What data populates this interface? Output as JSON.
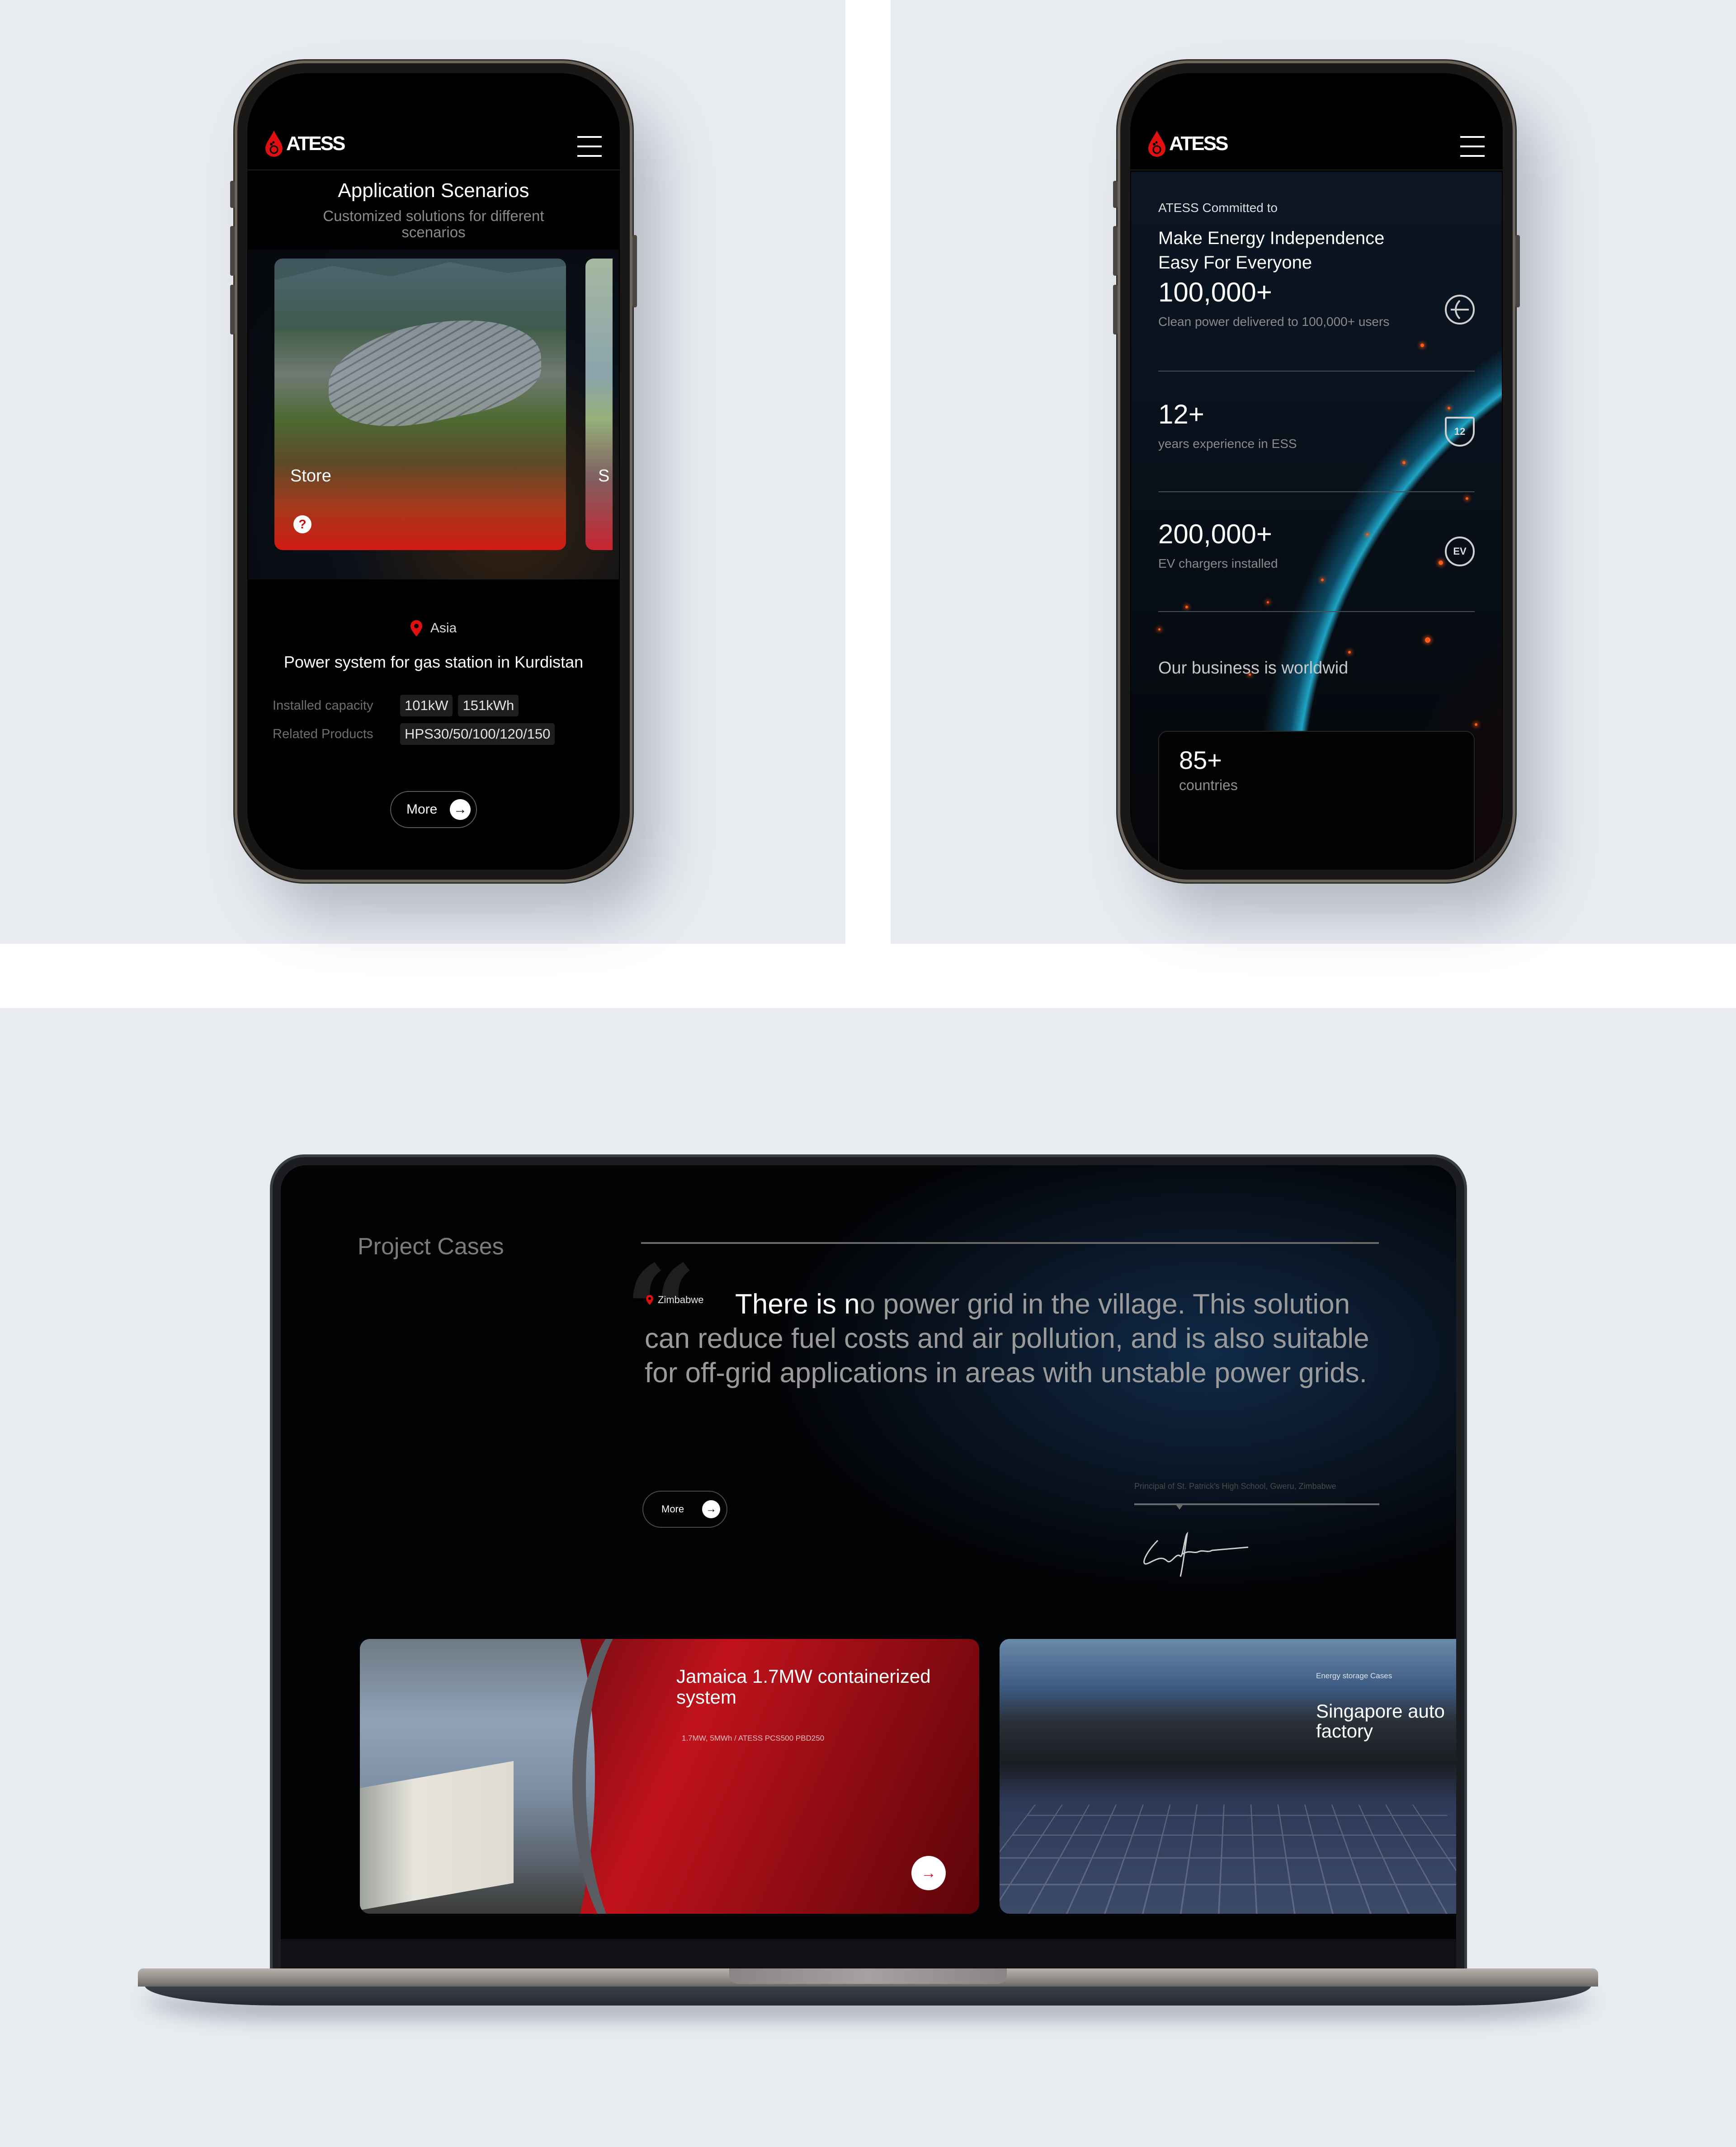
{
  "brand": {
    "name": "ATESS",
    "accent_color": "#d01a1a"
  },
  "phone_left": {
    "header": {
      "logo_text": "ATESS",
      "menu_icon": "hamburger-icon"
    },
    "section_title": "Application Scenarios",
    "section_subtitle": "Customized solutions for different scenarios",
    "cards": [
      {
        "label": "Store",
        "icon": "question-icon"
      },
      {
        "label": "S"
      }
    ],
    "project": {
      "region": "Asia",
      "title": "Power system for gas station in Kurdistan",
      "specs": [
        {
          "label": "Installed capacity",
          "values": [
            "101kW",
            "151kWh"
          ]
        },
        {
          "label": "Related Products",
          "values": [
            "HPS30/50/100/120/150"
          ]
        }
      ],
      "more_label": "More"
    }
  },
  "phone_right": {
    "header": {
      "logo_text": "ATESS",
      "menu_icon": "hamburger-icon"
    },
    "kicker": "ATESS Committed to",
    "title_line1": "Make Energy Independence",
    "title_line2": "Easy For Everyone",
    "stats": [
      {
        "value": "100,000+",
        "description": "Clean power delivered to 100,000+ users",
        "icon": "globe-icon"
      },
      {
        "value": "12+",
        "description": "years experience in ESS",
        "icon": "shield-12-icon",
        "icon_text": "12"
      },
      {
        "value": "200,000+",
        "description": "EV chargers installed",
        "icon": "ev-icon",
        "icon_text": "EV"
      }
    ],
    "worldwide_label": "Our business is worldwid",
    "countries": {
      "value": "85+",
      "description": "countries"
    }
  },
  "laptop": {
    "section_title": "Project Cases",
    "testimonial": {
      "location": "Zimbabwe",
      "quote_highlight": "There is n",
      "quote_rest": "o power grid in the village. This solution can reduce fuel costs and air pollution, and is also suitable for off-grid applications in areas with unstable power grids.",
      "attribution": "Principal of St. Patrick's High School, Gweru, Zimbabwe",
      "more_label": "More"
    },
    "cases": [
      {
        "title": "Jamaica 1.7MW containerized system",
        "spec": "1.7MW, 5MWh / ATESS PCS500 PBD250"
      },
      {
        "kicker": "Energy storage  Cases",
        "title": "Singapore auto factory"
      }
    ]
  }
}
